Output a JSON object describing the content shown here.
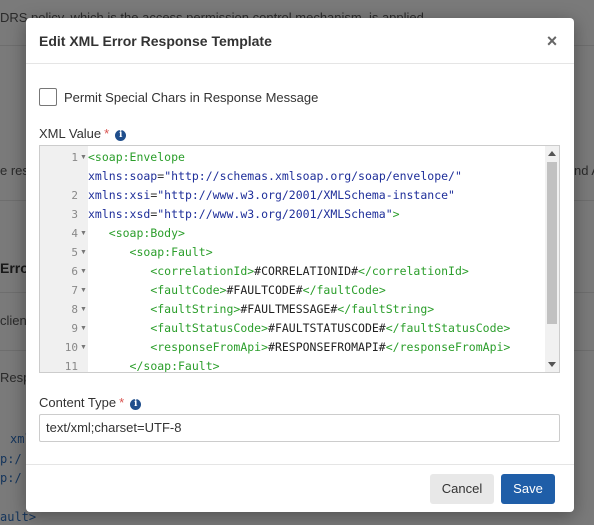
{
  "background": {
    "fragments": [
      "DRS policy, which is the access permission control mechanism, is applied",
      "e resp",
      "nd A",
      "Error R",
      "clien",
      "Resp",
      "xml",
      "p:/",
      "p:/",
      "ault>"
    ]
  },
  "modal": {
    "title": "Edit XML Error Response Template",
    "close_glyph": "×",
    "checkbox_label": "Permit Special Chars in Response Message",
    "xml_label": "XML Value",
    "required_mark": "*",
    "info_glyph": "i",
    "content_type_label": "Content Type",
    "content_type_value": "text/xml;charset=UTF-8",
    "cancel_label": "Cancel",
    "save_label": "Save"
  },
  "editor": {
    "gutter": [
      {
        "num": "1",
        "fold": "▼"
      },
      {
        "num": "",
        "fold": ""
      },
      {
        "num": "2",
        "fold": ""
      },
      {
        "num": "3",
        "fold": ""
      },
      {
        "num": "4",
        "fold": "▼"
      },
      {
        "num": "5",
        "fold": "▼"
      },
      {
        "num": "6",
        "fold": "▼"
      },
      {
        "num": "7",
        "fold": "▼"
      },
      {
        "num": "8",
        "fold": "▼"
      },
      {
        "num": "9",
        "fold": "▼"
      },
      {
        "num": "10",
        "fold": "▼"
      },
      {
        "num": "11",
        "fold": ""
      }
    ],
    "lines": [
      [
        {
          "t": "tag",
          "v": "<soap:Envelope"
        }
      ],
      [
        {
          "t": "attr",
          "v": "xmlns:soap"
        },
        {
          "t": "eq",
          "v": "="
        },
        {
          "t": "str",
          "v": "\"http://schemas.xmlsoap.org/soap/envelope/\""
        }
      ],
      [
        {
          "t": "attr",
          "v": "xmlns:xsi"
        },
        {
          "t": "eq",
          "v": "="
        },
        {
          "t": "str",
          "v": "\"http://www.w3.org/2001/XMLSchema-instance\""
        }
      ],
      [
        {
          "t": "attr",
          "v": "xmlns:xsd"
        },
        {
          "t": "eq",
          "v": "="
        },
        {
          "t": "str",
          "v": "\"http://www.w3.org/2001/XMLSchema\""
        },
        {
          "t": "tag",
          "v": ">"
        }
      ],
      [
        {
          "t": "txt",
          "v": "   "
        },
        {
          "t": "tag",
          "v": "<soap:Body>"
        }
      ],
      [
        {
          "t": "txt",
          "v": "      "
        },
        {
          "t": "tag",
          "v": "<soap:Fault>"
        }
      ],
      [
        {
          "t": "txt",
          "v": "         "
        },
        {
          "t": "tag",
          "v": "<correlationId>"
        },
        {
          "t": "txt",
          "v": "#CORRELATIONID#"
        },
        {
          "t": "tag",
          "v": "</correlationId>"
        }
      ],
      [
        {
          "t": "txt",
          "v": "         "
        },
        {
          "t": "tag",
          "v": "<faultCode>"
        },
        {
          "t": "txt",
          "v": "#FAULTCODE#"
        },
        {
          "t": "tag",
          "v": "</faultCode>"
        }
      ],
      [
        {
          "t": "txt",
          "v": "         "
        },
        {
          "t": "tag",
          "v": "<faultString>"
        },
        {
          "t": "txt",
          "v": "#FAULTMESSAGE#"
        },
        {
          "t": "tag",
          "v": "</faultString>"
        }
      ],
      [
        {
          "t": "txt",
          "v": "         "
        },
        {
          "t": "tag",
          "v": "<faultStatusCode>"
        },
        {
          "t": "txt",
          "v": "#FAULTSTATUSCODE#"
        },
        {
          "t": "tag",
          "v": "</faultStatusCode>"
        }
      ],
      [
        {
          "t": "txt",
          "v": "         "
        },
        {
          "t": "tag",
          "v": "<responseFromApi>"
        },
        {
          "t": "txt",
          "v": "#RESPONSEFROMAPI#"
        },
        {
          "t": "tag",
          "v": "</responseFromApi>"
        }
      ],
      [
        {
          "t": "txt",
          "v": "      "
        },
        {
          "t": "tag",
          "v": "</soap:Fault>"
        }
      ]
    ]
  }
}
